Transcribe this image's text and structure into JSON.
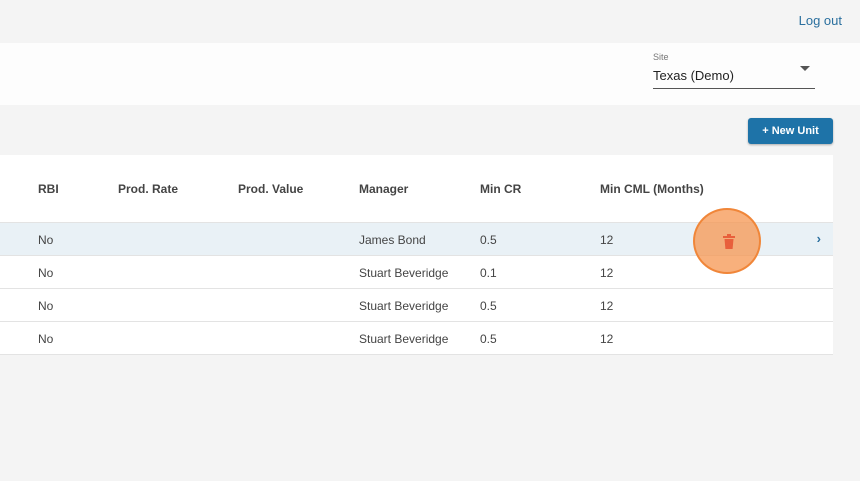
{
  "header": {
    "logout_label": "Log out"
  },
  "site_select": {
    "label": "Site",
    "value": "Texas (Demo)"
  },
  "toolbar": {
    "new_unit_label": "+ New Unit"
  },
  "table": {
    "columns": [
      "RBI",
      "Prod. Rate",
      "Prod. Value",
      "Manager",
      "Min CR",
      "Min CML (Months)"
    ],
    "rows": [
      {
        "rbi": "No",
        "prod_rate": "",
        "prod_value": "",
        "manager": "James Bond",
        "min_cr": "0.5",
        "min_cml": "12"
      },
      {
        "rbi": "No",
        "prod_rate": "",
        "prod_value": "",
        "manager": "Stuart Beveridge",
        "min_cr": "0.1",
        "min_cml": "12"
      },
      {
        "rbi": "No",
        "prod_rate": "",
        "prod_value": "",
        "manager": "Stuart Beveridge",
        "min_cr": "0.5",
        "min_cml": "12"
      },
      {
        "rbi": "No",
        "prod_rate": "",
        "prod_value": "",
        "manager": "Stuart Beveridge",
        "min_cr": "0.5",
        "min_cml": "12"
      }
    ],
    "row_chevron": "›"
  },
  "colors": {
    "accent": "#1e73a8",
    "highlight_row": "#e9f1f6",
    "delete_icon": "#e8603c",
    "cursor_ring": "#f5a05a"
  },
  "icons": {
    "delete": "trash-icon",
    "open_row": "chevron-right-icon",
    "dropdown": "chevron-down-icon"
  }
}
